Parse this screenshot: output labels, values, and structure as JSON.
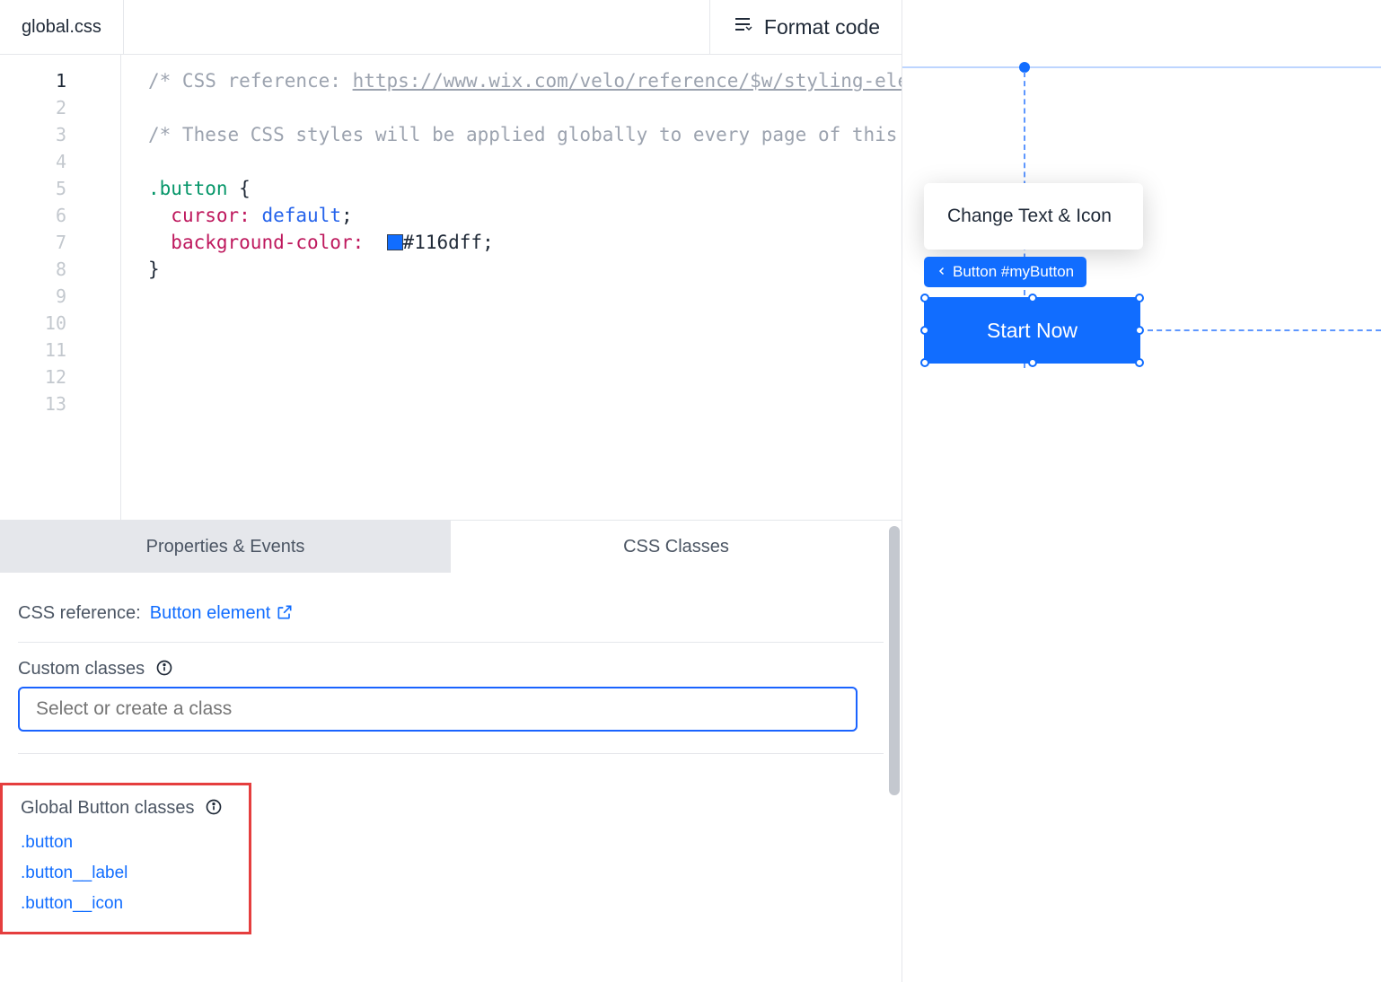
{
  "header": {
    "file_tab": "global.css",
    "format_button": "Format code"
  },
  "editor": {
    "line_numbers": [
      "1",
      "2",
      "3",
      "4",
      "5",
      "6",
      "7",
      "8",
      "9",
      "10",
      "11",
      "12",
      "13"
    ],
    "active_line": 1,
    "lines": {
      "l1_prefix": "/* CSS reference: ",
      "l1_link": "https://www.wix.com/velo/reference/$w/styling-elem",
      "l3": "/* These CSS styles will be applied globally to every page of this s",
      "l5_selector": ".button",
      "l6_prop": "cursor",
      "l6_val": "default",
      "l7_prop": "background-color",
      "l7_val": "#116dff"
    }
  },
  "props": {
    "tabs": {
      "properties": "Properties & Events",
      "css": "CSS Classes"
    },
    "css_ref_label": "CSS reference:",
    "css_ref_link": "Button element",
    "custom_classes_label": "Custom classes",
    "class_input_placeholder": "Select or create a class",
    "global_title": "Global Button classes",
    "global_classes": [
      ".button",
      ".button__label",
      ".button__icon"
    ]
  },
  "canvas": {
    "popup": "Change Text & Icon",
    "breadcrumb": "Button #myButton",
    "button_label": "Start Now",
    "accent": "#116dff"
  }
}
